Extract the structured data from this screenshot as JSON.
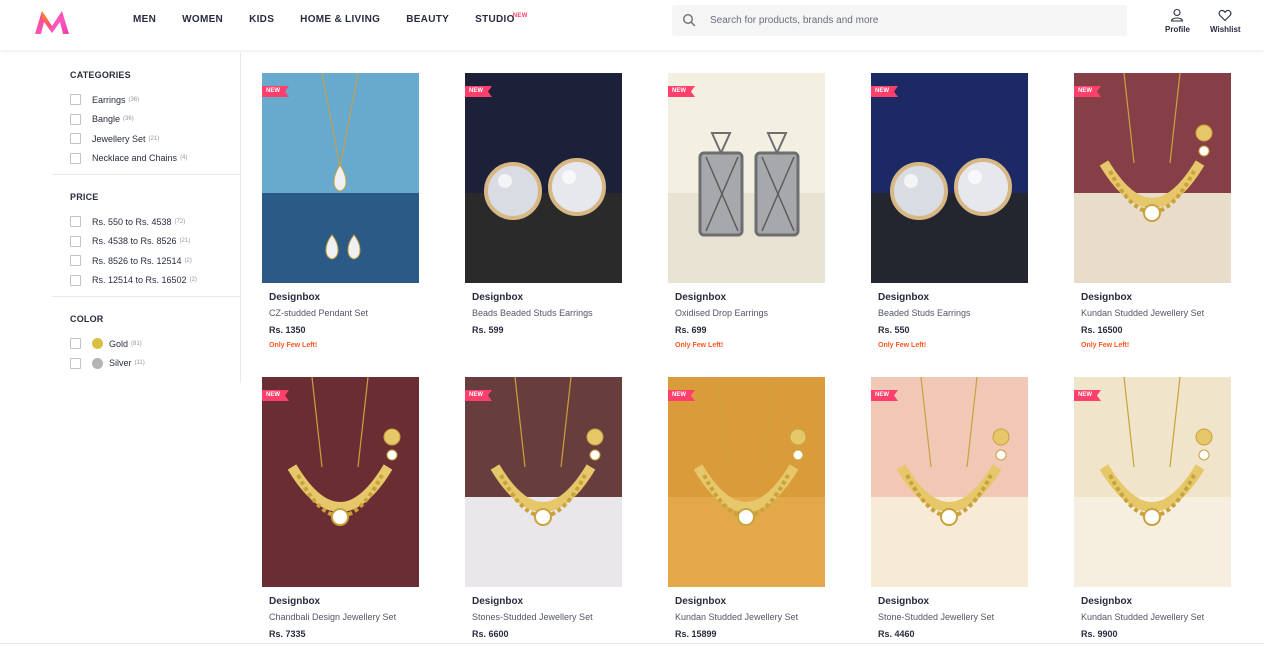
{
  "header": {
    "nav": [
      {
        "label": "MEN",
        "tag": ""
      },
      {
        "label": "WOMEN",
        "tag": ""
      },
      {
        "label": "KIDS",
        "tag": ""
      },
      {
        "label": "HOME & LIVING",
        "tag": ""
      },
      {
        "label": "BEAUTY",
        "tag": ""
      },
      {
        "label": "STUDIO",
        "tag": "NEW"
      }
    ],
    "search_placeholder": "Search for products, brands and more",
    "profile_label": "Profile",
    "wishlist_label": "Wishlist",
    "icons": {
      "logo": "myntra-logo",
      "search": "search-icon",
      "profile": "profile-icon",
      "wishlist": "heart-icon"
    }
  },
  "filters": {
    "categories": {
      "title": "CATEGORIES",
      "options": [
        {
          "label": "Earrings",
          "count": "(36)"
        },
        {
          "label": "Bangle",
          "count": "(36)"
        },
        {
          "label": "Jewellery Set",
          "count": "(21)"
        },
        {
          "label": "Necklace and Chains",
          "count": "(4)"
        }
      ]
    },
    "price": {
      "title": "PRICE",
      "options": [
        {
          "label": "Rs. 550 to Rs. 4538",
          "count": "(72)"
        },
        {
          "label": "Rs. 4538 to Rs. 8526",
          "count": "(21)"
        },
        {
          "label": "Rs. 8526 to Rs. 12514",
          "count": "(2)"
        },
        {
          "label": "Rs. 12514 to Rs. 16502",
          "count": "(2)"
        }
      ]
    },
    "color": {
      "title": "COLOR",
      "options": [
        {
          "label": "Gold",
          "count": "(81)",
          "swatch": "#d8c045"
        },
        {
          "label": "Silver",
          "count": "(11)",
          "swatch": "#b4b4b4"
        }
      ]
    }
  },
  "products": [
    {
      "badge": "NEW",
      "brand": "Designbox",
      "name": "CZ-studded Pendant Set",
      "price": "Rs. 1350",
      "stock": "Only Few Left!"
    },
    {
      "badge": "NEW",
      "brand": "Designbox",
      "name": "Beads Beaded Studs Earrings",
      "price": "Rs. 599",
      "stock": ""
    },
    {
      "badge": "NEW",
      "brand": "Designbox",
      "name": "Oxidised Drop Earrings",
      "price": "Rs. 699",
      "stock": "Only Few Left!"
    },
    {
      "badge": "NEW",
      "brand": "Designbox",
      "name": "Beaded Studs Earrings",
      "price": "Rs. 550",
      "stock": "Only Few Left!"
    },
    {
      "badge": "NEW",
      "brand": "Designbox",
      "name": "Kundan Studded Jewellery Set",
      "price": "Rs. 16500",
      "stock": "Only Few Left!"
    },
    {
      "badge": "NEW",
      "brand": "Designbox",
      "name": "Chandbali Design Jewellery Set",
      "price": "Rs. 7335",
      "stock": ""
    },
    {
      "badge": "NEW",
      "brand": "Designbox",
      "name": "Stones-Studded Jewellery Set",
      "price": "Rs. 6600",
      "stock": ""
    },
    {
      "badge": "NEW",
      "brand": "Designbox",
      "name": "Kundan Studded Jewellery Set",
      "price": "Rs. 15899",
      "stock": ""
    },
    {
      "badge": "NEW",
      "brand": "Designbox",
      "name": "Stone-Studded Jewellery Set",
      "price": "Rs. 4460",
      "stock": ""
    },
    {
      "badge": "NEW",
      "brand": "Designbox",
      "name": "Kundan Studded Jewellery Set",
      "price": "Rs. 9900",
      "stock": ""
    }
  ],
  "colors": {
    "accent": "#ff3f6c",
    "stock_warning": "#ff5722",
    "text": "#282c3f"
  }
}
